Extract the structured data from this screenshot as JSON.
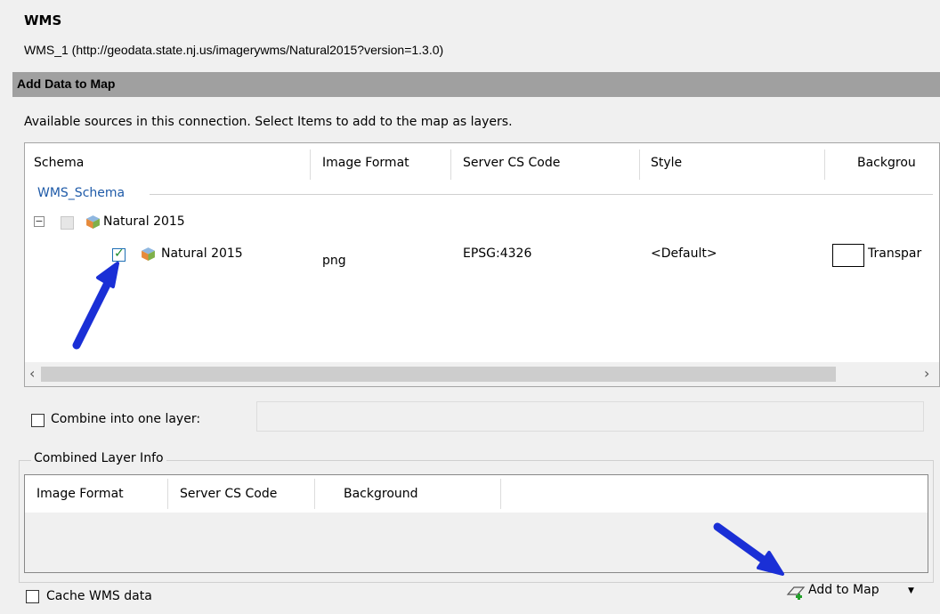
{
  "header": {
    "title": "WMS",
    "connection": "WMS_1 (http://geodata.state.nj.us/imagerywms/Natural2015?version=1.3.0)",
    "section_title": "Add Data to Map",
    "description": "Available sources in this connection.  Select Items to add to the map as layers."
  },
  "grid": {
    "columns": [
      "Schema",
      "Image Format",
      "Server CS Code",
      "Style",
      "Backgrou"
    ],
    "schema_group": "WMS_Schema",
    "parent": {
      "name": "Natural 2015"
    },
    "row": {
      "name": "Natural 2015",
      "checked": true,
      "image_format": "png",
      "server_cs_code": "EPSG:4326",
      "style": "<Default>",
      "background": "Transpar"
    }
  },
  "combine": {
    "label": "Combine into one layer:",
    "checked": false
  },
  "combined_info": {
    "title": "Combined Layer Info",
    "columns": [
      "Image Format",
      "Server CS Code",
      "Background"
    ]
  },
  "footer": {
    "cache_label": "Cache WMS data",
    "add_button": "Add to Map"
  },
  "colors": {
    "arrow": "#1a2fd6",
    "section_bar": "#a0a0a0",
    "link": "#1e5aa8"
  }
}
